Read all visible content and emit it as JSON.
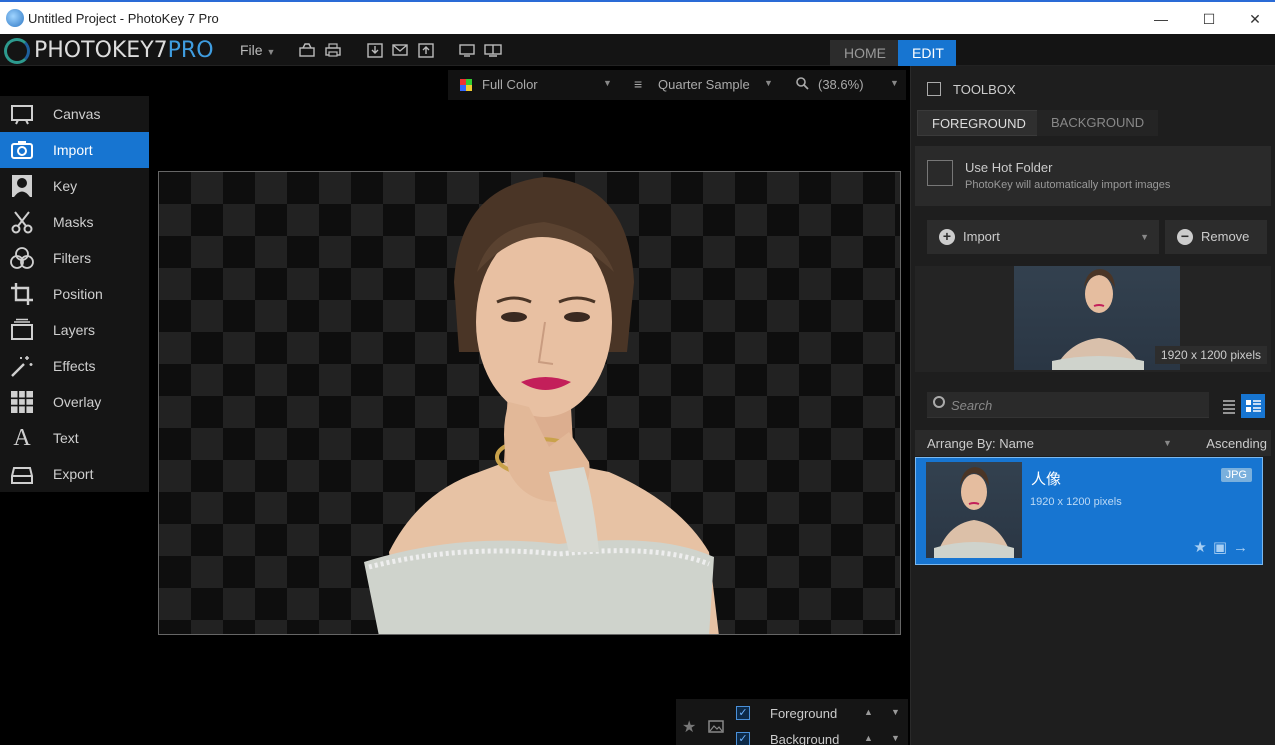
{
  "window": {
    "title": "Untitled Project - PhotoKey 7 Pro",
    "minimize": "—",
    "maximize": "☐",
    "close": "✕"
  },
  "menubar": {
    "logo_text": "PHOTOKEY7",
    "logo_pro": "PRO",
    "file_menu": "File",
    "toolbar_icons": [
      "new-file-icon",
      "print-icon",
      "save-icon",
      "email-icon",
      "export-icon",
      "monitor-icon",
      "dual-monitor-icon"
    ],
    "tabs": {
      "home": "HOME",
      "edit": "EDIT"
    }
  },
  "sidebar": {
    "items": [
      {
        "label": "Canvas",
        "icon": "canvas-icon"
      },
      {
        "label": "Import",
        "icon": "camera-icon",
        "active": true
      },
      {
        "label": "Key",
        "icon": "person-icon"
      },
      {
        "label": "Masks",
        "icon": "scissors-icon"
      },
      {
        "label": "Filters",
        "icon": "filters-icon"
      },
      {
        "label": "Position",
        "icon": "crop-icon"
      },
      {
        "label": "Layers",
        "icon": "layers-icon"
      },
      {
        "label": "Effects",
        "icon": "wand-icon"
      },
      {
        "label": "Overlay",
        "icon": "grid-icon"
      },
      {
        "label": "Text",
        "icon": "text-icon"
      },
      {
        "label": "Export",
        "icon": "export-icon"
      }
    ]
  },
  "viewbar": {
    "color_mode": "Full Color",
    "sample": "Quarter Sample",
    "zoom": "(38.6%)"
  },
  "layers": {
    "foreground": "Foreground",
    "background": "Background"
  },
  "toolbox": {
    "title": "TOOLBOX",
    "tab_foreground": "FOREGROUND",
    "tab_background": "BACKGROUND",
    "hot_folder_title": "Use Hot Folder",
    "hot_folder_desc": "PhotoKey will automatically import images",
    "import_label": "Import",
    "remove_label": "Remove",
    "preview_dims": "1920 x 1200 pixels",
    "search_placeholder": "Search",
    "arrange_by": "Arrange By: Name",
    "order": "Ascending",
    "item": {
      "name": "人像",
      "dims": "1920 x 1200 pixels",
      "format": "JPG"
    }
  }
}
